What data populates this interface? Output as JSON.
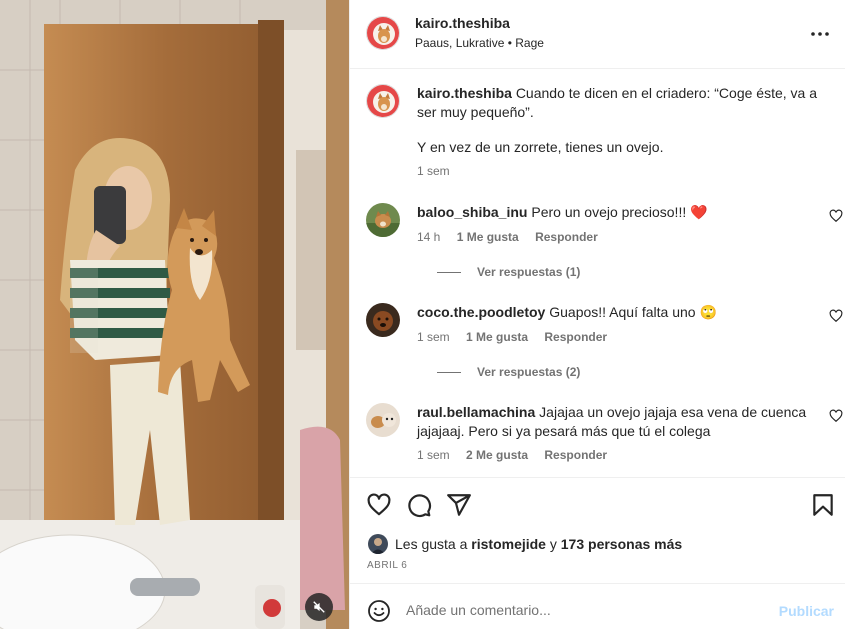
{
  "post": {
    "username": "kairo.theshiba",
    "audio": "Paaus, Lukrative • Rage"
  },
  "caption": {
    "username": "kairo.theshiba",
    "line1": "Cuando te dicen en el criadero: “Coge éste, va a ser muy pequeño”.",
    "line2": "Y en vez de un zorrete, tienes un ovejo.",
    "time": "1 sem"
  },
  "comments": [
    {
      "username": "baloo_shiba_inu",
      "text": "Pero un ovejo precioso!!! ❤️",
      "time": "14 h",
      "likes": "1 Me gusta",
      "reply": "Responder",
      "view_replies": "Ver respuestas (1)"
    },
    {
      "username": "coco.the.poodletoy",
      "text": "Guapos!! Aquí falta uno 🙄",
      "time": "1 sem",
      "likes": "1 Me gusta",
      "reply": "Responder",
      "view_replies": "Ver respuestas (2)"
    },
    {
      "username": "raul.bellamachina",
      "text": "Jajajaa un ovejo jajaja esa vena de cuenca jajajaaj. Pero si ya pesará más que tú el colega",
      "time": "1 sem",
      "likes": "2 Me gusta",
      "reply": "Responder"
    }
  ],
  "likes_bar": {
    "prefix": "Les gusta a",
    "user": "ristomejide",
    "joiner": "y",
    "others": "173 personas más"
  },
  "date": "ABRIL 6",
  "composer": {
    "placeholder": "Añade un comentario...",
    "publish": "Publicar"
  },
  "icons": [
    "more-horizontal-icon",
    "heart-icon",
    "comment-icon",
    "share-icon",
    "bookmark-icon",
    "emoji-icon",
    "muted-speaker-icon"
  ],
  "colors": {
    "text": "#262626",
    "secondary": "#737373",
    "divider": "#efefef",
    "publish_disabled": "#b3dbff",
    "heart_red": "#ed4956"
  }
}
